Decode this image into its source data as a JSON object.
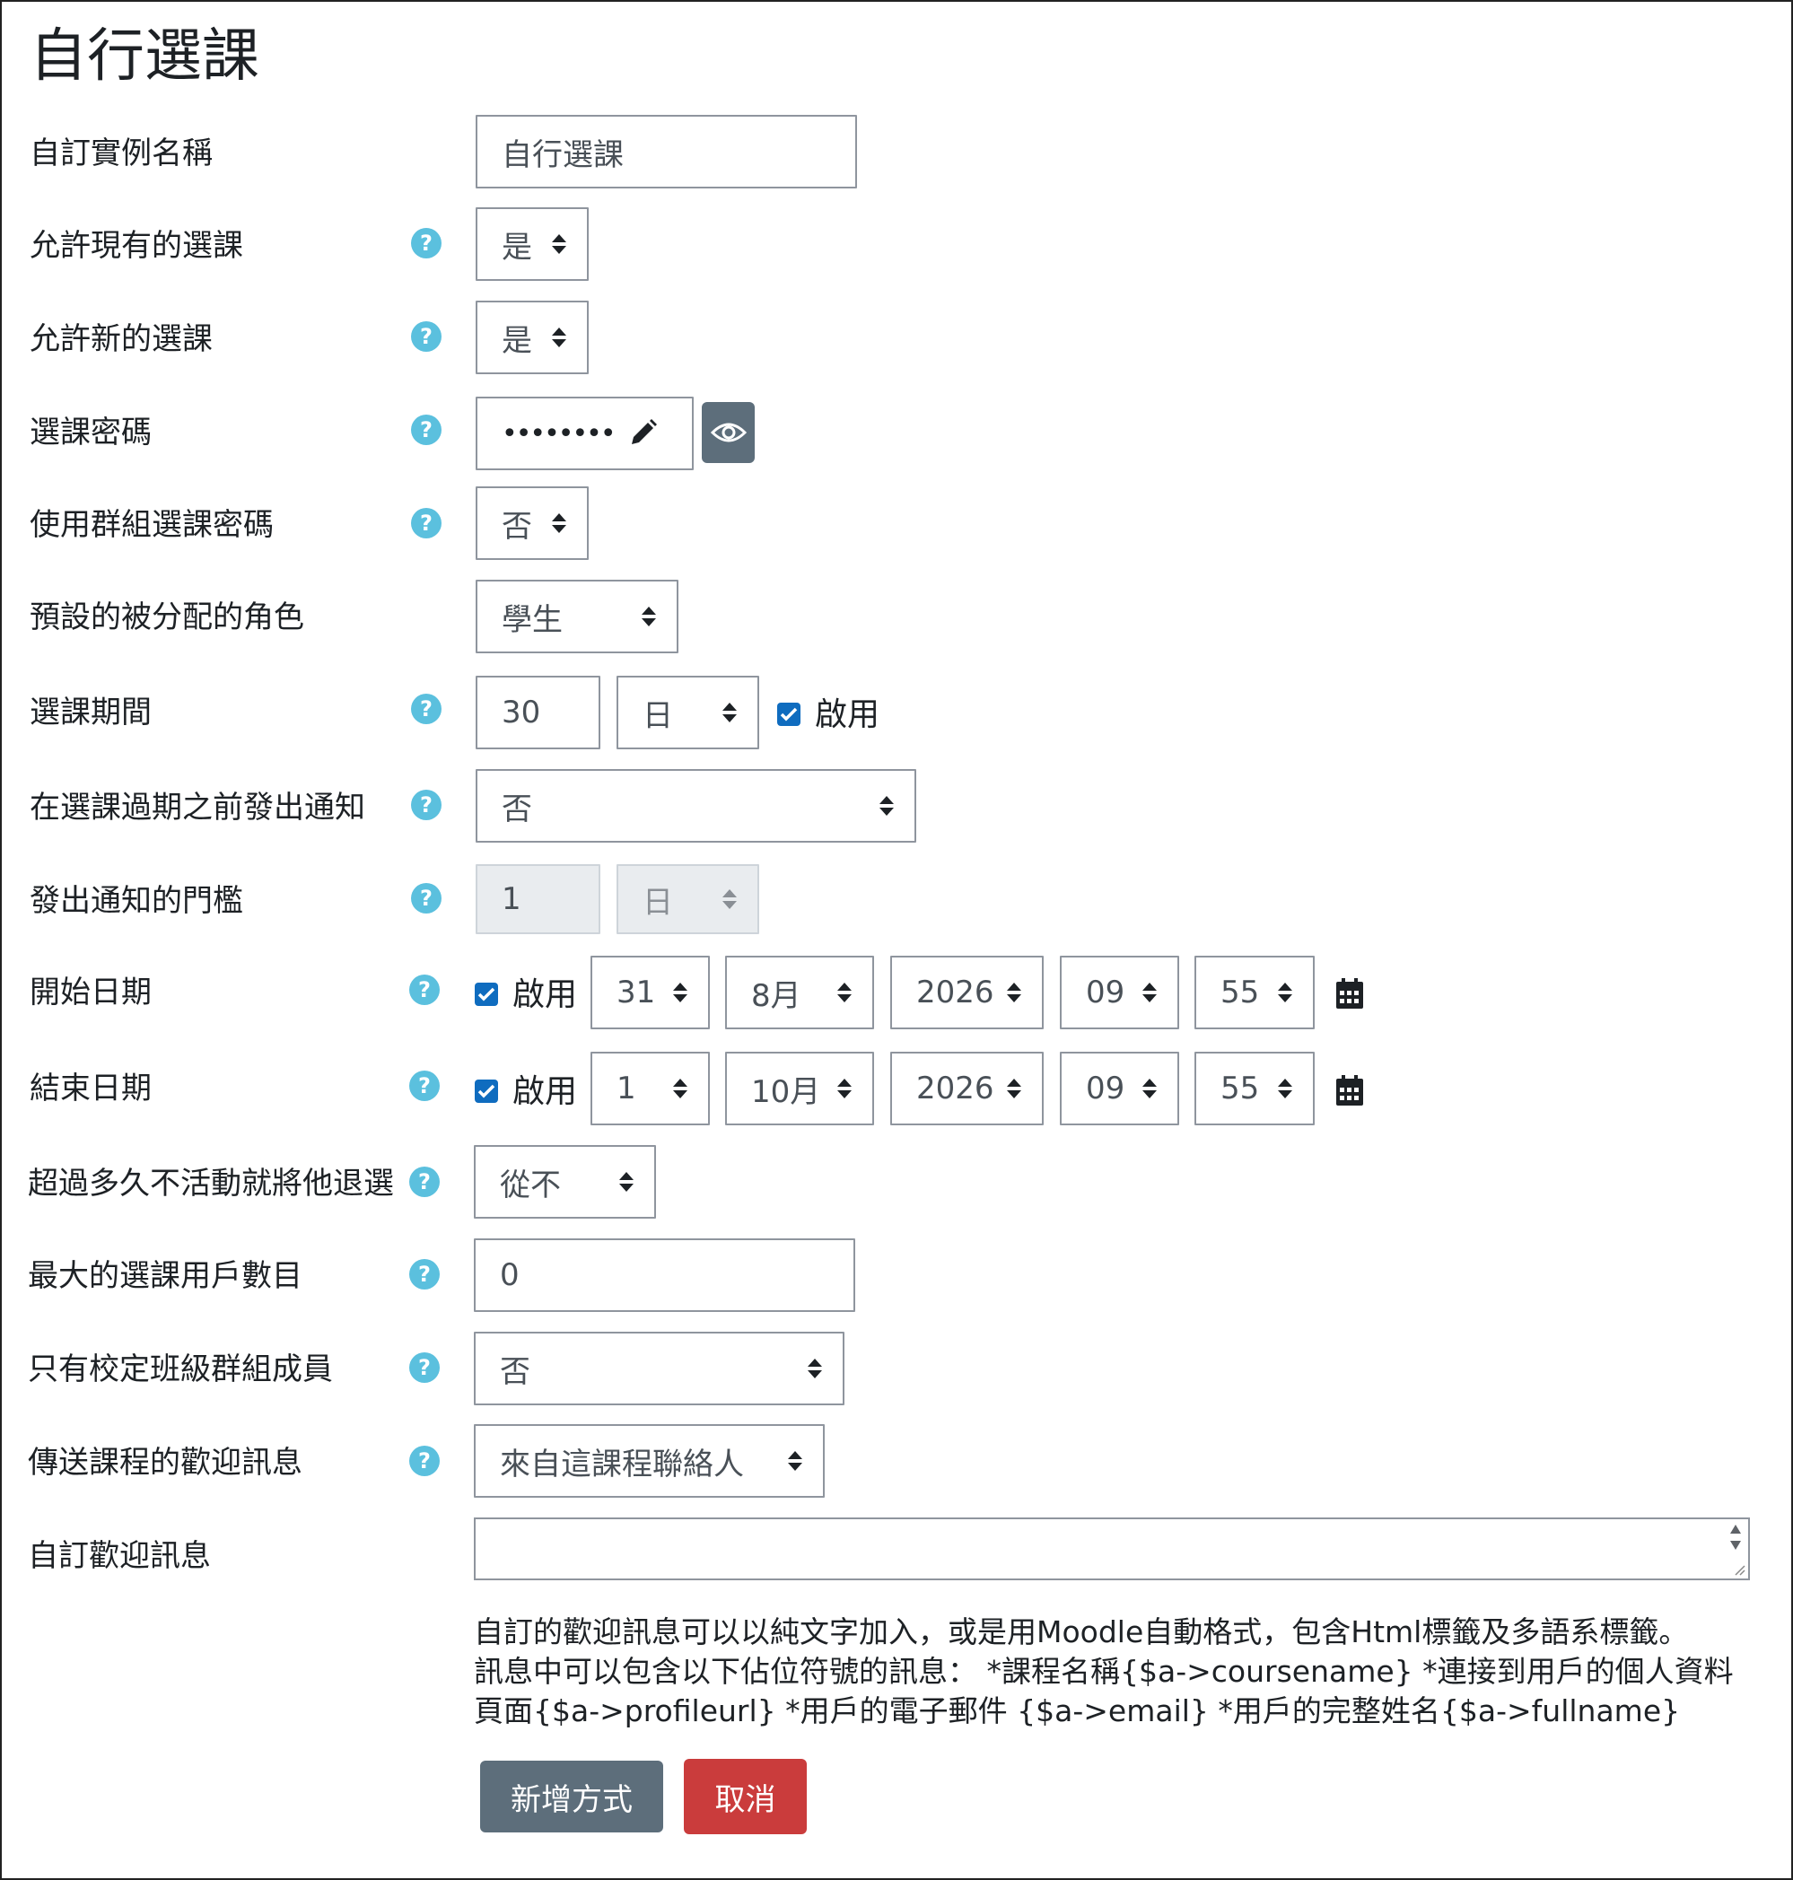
{
  "page_title": "自行選課",
  "fields": {
    "instance_name": {
      "label": "自訂實例名稱",
      "value": "自行選課"
    },
    "allow_existing": {
      "label": "允許現有的選課",
      "value": "是"
    },
    "allow_new": {
      "label": "允許新的選課",
      "value": "是"
    },
    "password": {
      "label": "選課密碼",
      "masked_value": "••••••••"
    },
    "group_key": {
      "label": "使用群組選課密碼",
      "value": "否"
    },
    "default_role": {
      "label": "預設的被分配的角色",
      "value": "學生"
    },
    "enrol_period": {
      "label": "選課期間",
      "number": "30",
      "unit": "日",
      "enable_label": "啟用"
    },
    "expiry_notify": {
      "label": "在選課過期之前發出通知",
      "value": "否"
    },
    "expiry_threshold": {
      "label": "發出通知的門檻",
      "number": "1",
      "unit": "日"
    },
    "start_date": {
      "label": "開始日期",
      "enable_label": "啟用",
      "day": "31",
      "month": "8月",
      "year": "2026",
      "hour": "09",
      "minute": "55"
    },
    "end_date": {
      "label": "結束日期",
      "enable_label": "啟用",
      "day": "1",
      "month": "10月",
      "year": "2026",
      "hour": "09",
      "minute": "55"
    },
    "longtime_nosee": {
      "label": "超過多久不活動就將他退選",
      "value": "從不"
    },
    "max_enrolled": {
      "label": "最大的選課用戶數目",
      "value": "0"
    },
    "cohort_only": {
      "label": "只有校定班級群組成員",
      "value": "否"
    },
    "welcome_message_sender": {
      "label": "傳送課程的歡迎訊息",
      "value": "來自這課程聯絡人"
    },
    "custom_welcome": {
      "label": "自訂歡迎訊息",
      "value": ""
    }
  },
  "help_text": {
    "line1": "自訂的歡迎訊息可以以純文字加入，或是用Moodle自動格式，包含Html標籤及多語系標籤。",
    "line2": "訊息中可以包含以下佔位符號的訊息： *課程名稱{$a->coursename} *連接到用戶的個人資料",
    "line3": "頁面{$a->profileurl} *用戶的電子郵件 {$a->email} *用戶的完整姓名{$a->fullname}"
  },
  "buttons": {
    "submit": "新增方式",
    "cancel": "取消"
  },
  "colors": {
    "help_icon": "#5bc0de",
    "primary": "#5d6e7b",
    "danger": "#ca3c3c",
    "checkbox": "#0f6cbf"
  }
}
